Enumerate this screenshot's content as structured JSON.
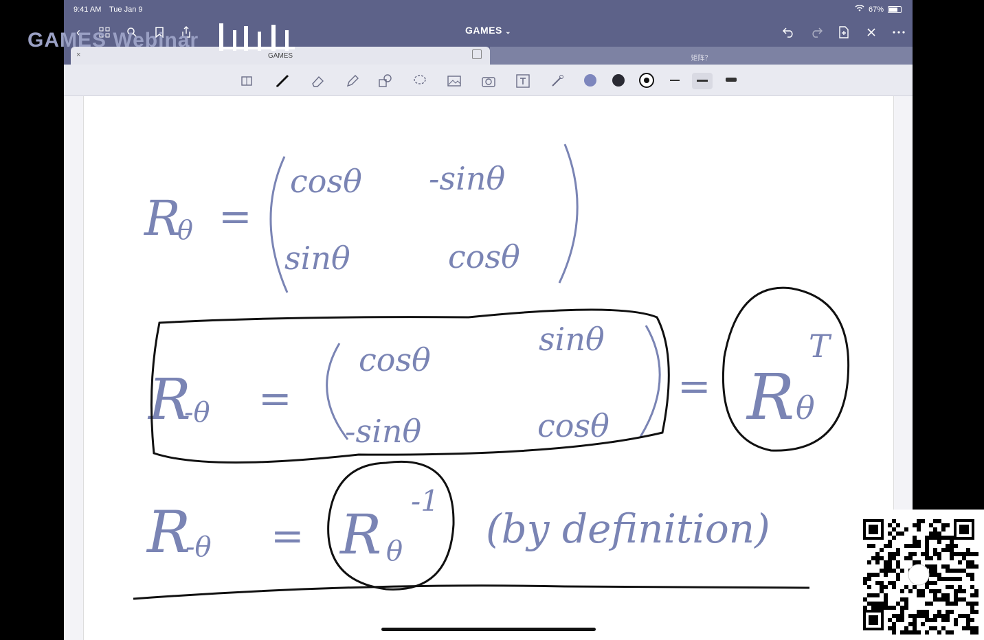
{
  "status_bar": {
    "time": "9:41 AM",
    "date": "Tue Jan 9",
    "battery": "67%"
  },
  "document": {
    "title": "GAMES",
    "title_arrow": "⌄"
  },
  "tabs": [
    {
      "label": "GAMES",
      "active": true
    },
    {
      "label": "矩阵？",
      "active": false
    }
  ],
  "watermark": {
    "text": "GAMES Webinar"
  },
  "handwriting": {
    "line1_left": "R",
    "line1_sub": "θ",
    "eq": "=",
    "m1": {
      "r1c1": "cosθ",
      "r1c2": "-sinθ",
      "r2c1": "sinθ",
      "r2c2": "cosθ"
    },
    "line2_left": "R",
    "line2_sub": "-θ",
    "m2": {
      "r1c1": "cosθ",
      "r1c2": "sinθ",
      "r2c1": "-sinθ",
      "r2c2": "cosθ"
    },
    "line2_right": "R",
    "line2_right_sub": "θ",
    "transpose": "T",
    "line3_left": "R",
    "line3_sub": "-θ",
    "line3_right": "R",
    "line3_right_sub": "θ",
    "inverse": "-1",
    "note": "(by definition)"
  },
  "colors": {
    "nav": "#5d6289",
    "ink_blue": "#7a84b4",
    "ink_black": "#111111",
    "swatch_blue": "#7d86bd"
  }
}
